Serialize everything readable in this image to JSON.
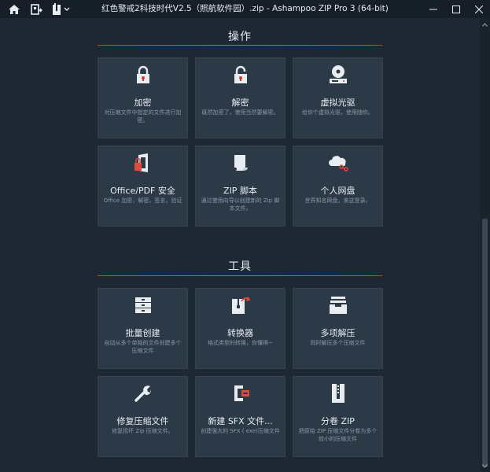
{
  "window": {
    "title": "红色警戒2科技时代V2.5（照航软件园）.zip - Ashampoo ZIP Pro 3 (64-bit)"
  },
  "sections": {
    "operations": {
      "title": "操作",
      "tiles": [
        {
          "label": "加密",
          "desc": "对压缩文件中指定的文件进行加密。"
        },
        {
          "label": "解密",
          "desc": "既然加密了，使用当然要解密。"
        },
        {
          "label": "虚拟光驱",
          "desc": "给你个虚拟光驱，使用随你。"
        },
        {
          "label": "Office/PDF 安全",
          "desc": "Office 加密，解密，签名，验证"
        },
        {
          "label": "ZIP 脚本",
          "desc": "通过使用向导以创建新的 Zip 脚本文件。"
        },
        {
          "label": "个人网盘",
          "desc": "世界知名网盘，来这登录。"
        }
      ]
    },
    "tools": {
      "title": "工具",
      "tiles": [
        {
          "label": "批量创建",
          "desc": "自动从多个单独的文件创建多个压缩文件"
        },
        {
          "label": "转换器",
          "desc": "格式类型的转换，你懂得~"
        },
        {
          "label": "多项解压",
          "desc": "同时解压多个压缩文件"
        },
        {
          "label": "修复压缩文件",
          "desc": "修复损坏 Zip 压缩文件。"
        },
        {
          "label": "新建 SFX 文件...",
          "desc": "创建强大的 SFX ( exe)压缩文件"
        },
        {
          "label": "分卷 ZIP",
          "desc": "把原始 ZIP 压缩文件分卷为多个较小的压缩文件"
        }
      ]
    }
  },
  "colors": {
    "accent": "#e04a3c",
    "background": "#1e2835",
    "tile": "#2c3947"
  }
}
